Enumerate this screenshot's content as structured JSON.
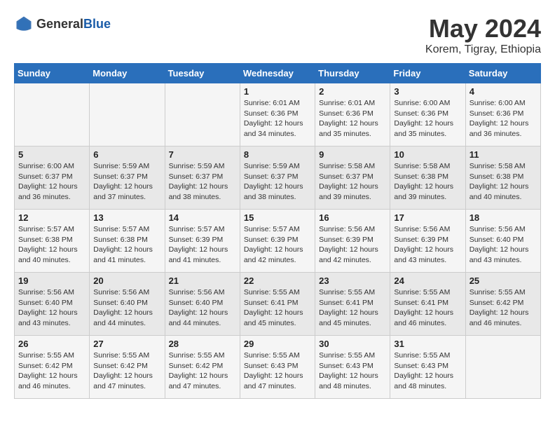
{
  "header": {
    "logo_general": "General",
    "logo_blue": "Blue",
    "month_year": "May 2024",
    "location": "Korem, Tigray, Ethiopia"
  },
  "days_of_week": [
    "Sunday",
    "Monday",
    "Tuesday",
    "Wednesday",
    "Thursday",
    "Friday",
    "Saturday"
  ],
  "weeks": [
    [
      {
        "day": "",
        "info": ""
      },
      {
        "day": "",
        "info": ""
      },
      {
        "day": "",
        "info": ""
      },
      {
        "day": "1",
        "info": "Sunrise: 6:01 AM\nSunset: 6:36 PM\nDaylight: 12 hours\nand 34 minutes."
      },
      {
        "day": "2",
        "info": "Sunrise: 6:01 AM\nSunset: 6:36 PM\nDaylight: 12 hours\nand 35 minutes."
      },
      {
        "day": "3",
        "info": "Sunrise: 6:00 AM\nSunset: 6:36 PM\nDaylight: 12 hours\nand 35 minutes."
      },
      {
        "day": "4",
        "info": "Sunrise: 6:00 AM\nSunset: 6:36 PM\nDaylight: 12 hours\nand 36 minutes."
      }
    ],
    [
      {
        "day": "5",
        "info": "Sunrise: 6:00 AM\nSunset: 6:37 PM\nDaylight: 12 hours\nand 36 minutes."
      },
      {
        "day": "6",
        "info": "Sunrise: 5:59 AM\nSunset: 6:37 PM\nDaylight: 12 hours\nand 37 minutes."
      },
      {
        "day": "7",
        "info": "Sunrise: 5:59 AM\nSunset: 6:37 PM\nDaylight: 12 hours\nand 38 minutes."
      },
      {
        "day": "8",
        "info": "Sunrise: 5:59 AM\nSunset: 6:37 PM\nDaylight: 12 hours\nand 38 minutes."
      },
      {
        "day": "9",
        "info": "Sunrise: 5:58 AM\nSunset: 6:37 PM\nDaylight: 12 hours\nand 39 minutes."
      },
      {
        "day": "10",
        "info": "Sunrise: 5:58 AM\nSunset: 6:38 PM\nDaylight: 12 hours\nand 39 minutes."
      },
      {
        "day": "11",
        "info": "Sunrise: 5:58 AM\nSunset: 6:38 PM\nDaylight: 12 hours\nand 40 minutes."
      }
    ],
    [
      {
        "day": "12",
        "info": "Sunrise: 5:57 AM\nSunset: 6:38 PM\nDaylight: 12 hours\nand 40 minutes."
      },
      {
        "day": "13",
        "info": "Sunrise: 5:57 AM\nSunset: 6:38 PM\nDaylight: 12 hours\nand 41 minutes."
      },
      {
        "day": "14",
        "info": "Sunrise: 5:57 AM\nSunset: 6:39 PM\nDaylight: 12 hours\nand 41 minutes."
      },
      {
        "day": "15",
        "info": "Sunrise: 5:57 AM\nSunset: 6:39 PM\nDaylight: 12 hours\nand 42 minutes."
      },
      {
        "day": "16",
        "info": "Sunrise: 5:56 AM\nSunset: 6:39 PM\nDaylight: 12 hours\nand 42 minutes."
      },
      {
        "day": "17",
        "info": "Sunrise: 5:56 AM\nSunset: 6:39 PM\nDaylight: 12 hours\nand 43 minutes."
      },
      {
        "day": "18",
        "info": "Sunrise: 5:56 AM\nSunset: 6:40 PM\nDaylight: 12 hours\nand 43 minutes."
      }
    ],
    [
      {
        "day": "19",
        "info": "Sunrise: 5:56 AM\nSunset: 6:40 PM\nDaylight: 12 hours\nand 43 minutes."
      },
      {
        "day": "20",
        "info": "Sunrise: 5:56 AM\nSunset: 6:40 PM\nDaylight: 12 hours\nand 44 minutes."
      },
      {
        "day": "21",
        "info": "Sunrise: 5:56 AM\nSunset: 6:40 PM\nDaylight: 12 hours\nand 44 minutes."
      },
      {
        "day": "22",
        "info": "Sunrise: 5:55 AM\nSunset: 6:41 PM\nDaylight: 12 hours\nand 45 minutes."
      },
      {
        "day": "23",
        "info": "Sunrise: 5:55 AM\nSunset: 6:41 PM\nDaylight: 12 hours\nand 45 minutes."
      },
      {
        "day": "24",
        "info": "Sunrise: 5:55 AM\nSunset: 6:41 PM\nDaylight: 12 hours\nand 46 minutes."
      },
      {
        "day": "25",
        "info": "Sunrise: 5:55 AM\nSunset: 6:42 PM\nDaylight: 12 hours\nand 46 minutes."
      }
    ],
    [
      {
        "day": "26",
        "info": "Sunrise: 5:55 AM\nSunset: 6:42 PM\nDaylight: 12 hours\nand 46 minutes."
      },
      {
        "day": "27",
        "info": "Sunrise: 5:55 AM\nSunset: 6:42 PM\nDaylight: 12 hours\nand 47 minutes."
      },
      {
        "day": "28",
        "info": "Sunrise: 5:55 AM\nSunset: 6:42 PM\nDaylight: 12 hours\nand 47 minutes."
      },
      {
        "day": "29",
        "info": "Sunrise: 5:55 AM\nSunset: 6:43 PM\nDaylight: 12 hours\nand 47 minutes."
      },
      {
        "day": "30",
        "info": "Sunrise: 5:55 AM\nSunset: 6:43 PM\nDaylight: 12 hours\nand 48 minutes."
      },
      {
        "day": "31",
        "info": "Sunrise: 5:55 AM\nSunset: 6:43 PM\nDaylight: 12 hours\nand 48 minutes."
      },
      {
        "day": "",
        "info": ""
      }
    ]
  ]
}
